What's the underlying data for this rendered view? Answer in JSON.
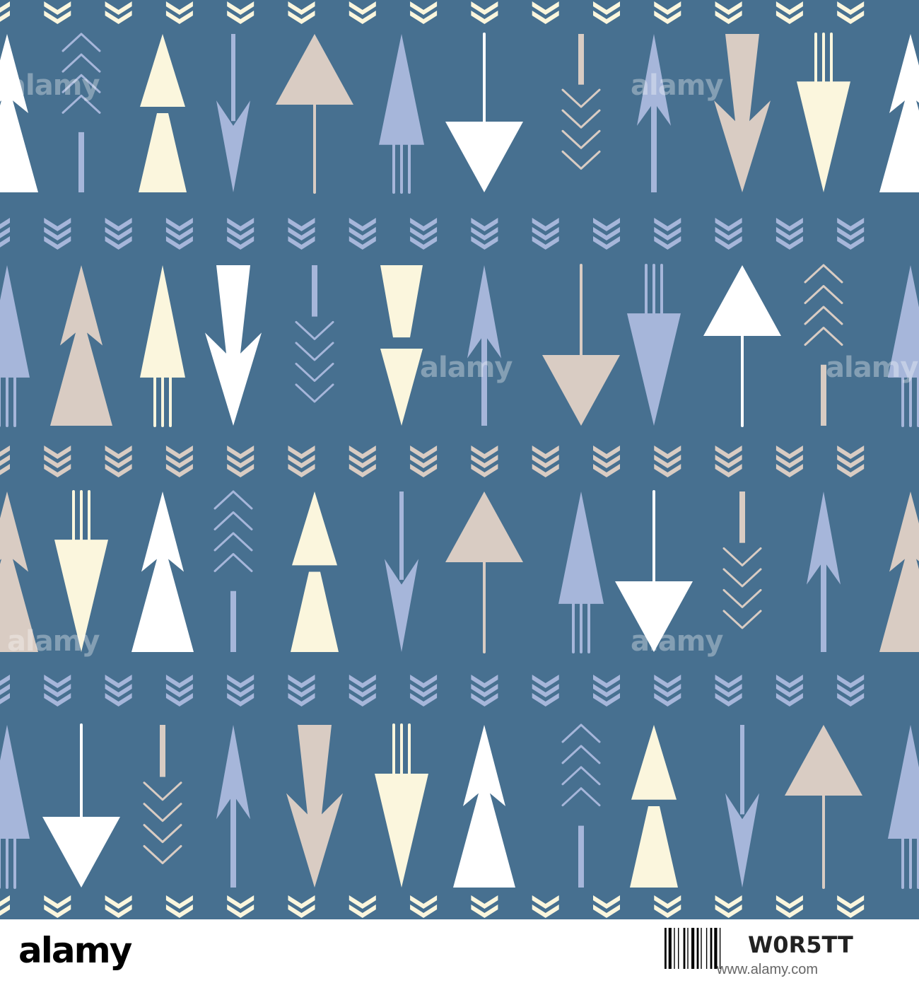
{
  "colors": {
    "background": "#477090",
    "white": "#FFFFFF",
    "cream": "#FBF6DD",
    "beige": "#D9CCC3",
    "blue": "#A6B6DA"
  },
  "pattern": {
    "description_icon": "hand-drawn-arrows-seamless-pattern",
    "chevron_bands": [
      {
        "color": "cream"
      },
      {
        "color": "blue"
      },
      {
        "color": "beige"
      },
      {
        "color": "blue"
      },
      {
        "color": "cream"
      }
    ],
    "arrow_rows": [
      {
        "arrows": [
          {
            "kind": "double-tree",
            "color": "white"
          },
          {
            "kind": "feather-up",
            "color": "blue"
          },
          {
            "kind": "split-triangle-up",
            "color": "cream"
          },
          {
            "kind": "spear-down",
            "color": "blue"
          },
          {
            "kind": "triangle-stem-up",
            "color": "beige"
          },
          {
            "kind": "tree-prongs",
            "color": "blue"
          },
          {
            "kind": "arrow-down-stem",
            "color": "white"
          },
          {
            "kind": "feather-down",
            "color": "beige"
          },
          {
            "kind": "spear-up",
            "color": "blue"
          },
          {
            "kind": "tapered-down",
            "color": "beige"
          },
          {
            "kind": "prong-triangle-down",
            "color": "cream"
          },
          {
            "kind": "double-tree",
            "color": "white"
          }
        ]
      },
      {
        "arrows": [
          {
            "kind": "tree-prongs",
            "color": "blue"
          },
          {
            "kind": "double-tree",
            "color": "beige"
          },
          {
            "kind": "tree-prongs",
            "color": "cream"
          },
          {
            "kind": "tapered-down",
            "color": "white"
          },
          {
            "kind": "feather-down",
            "color": "blue"
          },
          {
            "kind": "split-triangle-down",
            "color": "cream"
          },
          {
            "kind": "spear-up",
            "color": "blue"
          },
          {
            "kind": "arrow-down-stem",
            "color": "beige"
          },
          {
            "kind": "prong-triangle-down",
            "color": "blue"
          },
          {
            "kind": "triangle-stem-up",
            "color": "white"
          },
          {
            "kind": "feather-up",
            "color": "beige"
          },
          {
            "kind": "tree-prongs",
            "color": "blue"
          }
        ]
      },
      {
        "arrows": [
          {
            "kind": "double-tree",
            "color": "beige"
          },
          {
            "kind": "prong-triangle-down",
            "color": "cream"
          },
          {
            "kind": "double-tree",
            "color": "white"
          },
          {
            "kind": "feather-up",
            "color": "blue"
          },
          {
            "kind": "split-triangle-up",
            "color": "cream"
          },
          {
            "kind": "spear-down",
            "color": "blue"
          },
          {
            "kind": "triangle-stem-up",
            "color": "beige"
          },
          {
            "kind": "tree-prongs",
            "color": "blue"
          },
          {
            "kind": "arrow-down-stem",
            "color": "white"
          },
          {
            "kind": "feather-down",
            "color": "beige"
          },
          {
            "kind": "spear-up",
            "color": "blue"
          },
          {
            "kind": "double-tree",
            "color": "beige"
          }
        ]
      },
      {
        "arrows": [
          {
            "kind": "tree-prongs",
            "color": "blue"
          },
          {
            "kind": "arrow-down-stem",
            "color": "white"
          },
          {
            "kind": "feather-down",
            "color": "beige"
          },
          {
            "kind": "spear-up",
            "color": "blue"
          },
          {
            "kind": "tapered-down",
            "color": "beige"
          },
          {
            "kind": "prong-triangle-down",
            "color": "cream"
          },
          {
            "kind": "double-tree",
            "color": "white"
          },
          {
            "kind": "feather-up",
            "color": "blue"
          },
          {
            "kind": "split-triangle-up",
            "color": "cream"
          },
          {
            "kind": "spear-down",
            "color": "blue"
          },
          {
            "kind": "triangle-stem-up",
            "color": "beige"
          },
          {
            "kind": "tree-prongs",
            "color": "blue"
          }
        ]
      }
    ]
  },
  "watermark": {
    "text": "alamy"
  },
  "footer": {
    "logo": "alamy",
    "image_id": "W0R5TT",
    "url": "www.alamy.com"
  }
}
